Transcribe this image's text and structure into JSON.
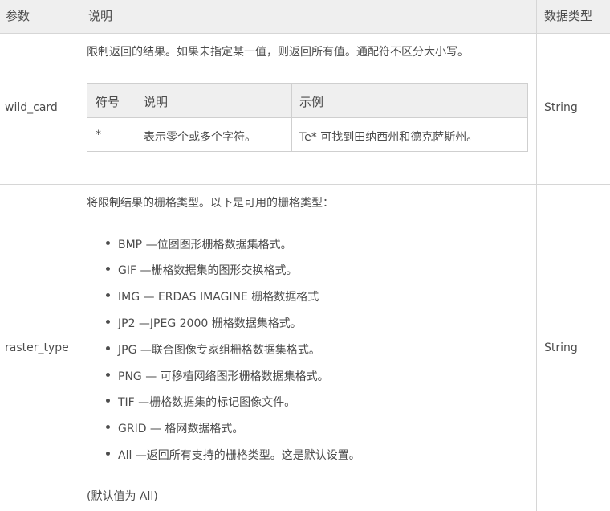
{
  "header": {
    "param": "参数",
    "desc": "说明",
    "type": "数据类型"
  },
  "rows": [
    {
      "name": "wild_card",
      "desc": "限制返回的结果。如果未指定某一值，则返回所有值。通配符不区分大小写。",
      "type": "String",
      "inner_table": {
        "headers": [
          "符号",
          "说明",
          "示例"
        ],
        "row": [
          "*",
          "表示零个或多个字符。",
          "Te* 可找到田纳西州和德克萨斯州。"
        ]
      }
    },
    {
      "name": "raster_type",
      "desc": "将限制结果的栅格类型。以下是可用的栅格类型：",
      "type": "String",
      "list": [
        "BMP —位图图形栅格数据集格式。",
        "GIF —栅格数据集的图形交换格式。",
        "IMG — ERDAS IMAGINE 栅格数据格式",
        "JP2 —JPEG 2000 栅格数据集格式。",
        "JPG —联合图像专家组栅格数据集格式。",
        "PNG — 可移植网络图形栅格数据集格式。",
        "TIF —栅格数据集的标记图像文件。",
        "GRID — 格网数据格式。",
        "All —返回所有支持的栅格类型。这是默认设置。"
      ],
      "default_note": "(默认值为 All)"
    }
  ]
}
